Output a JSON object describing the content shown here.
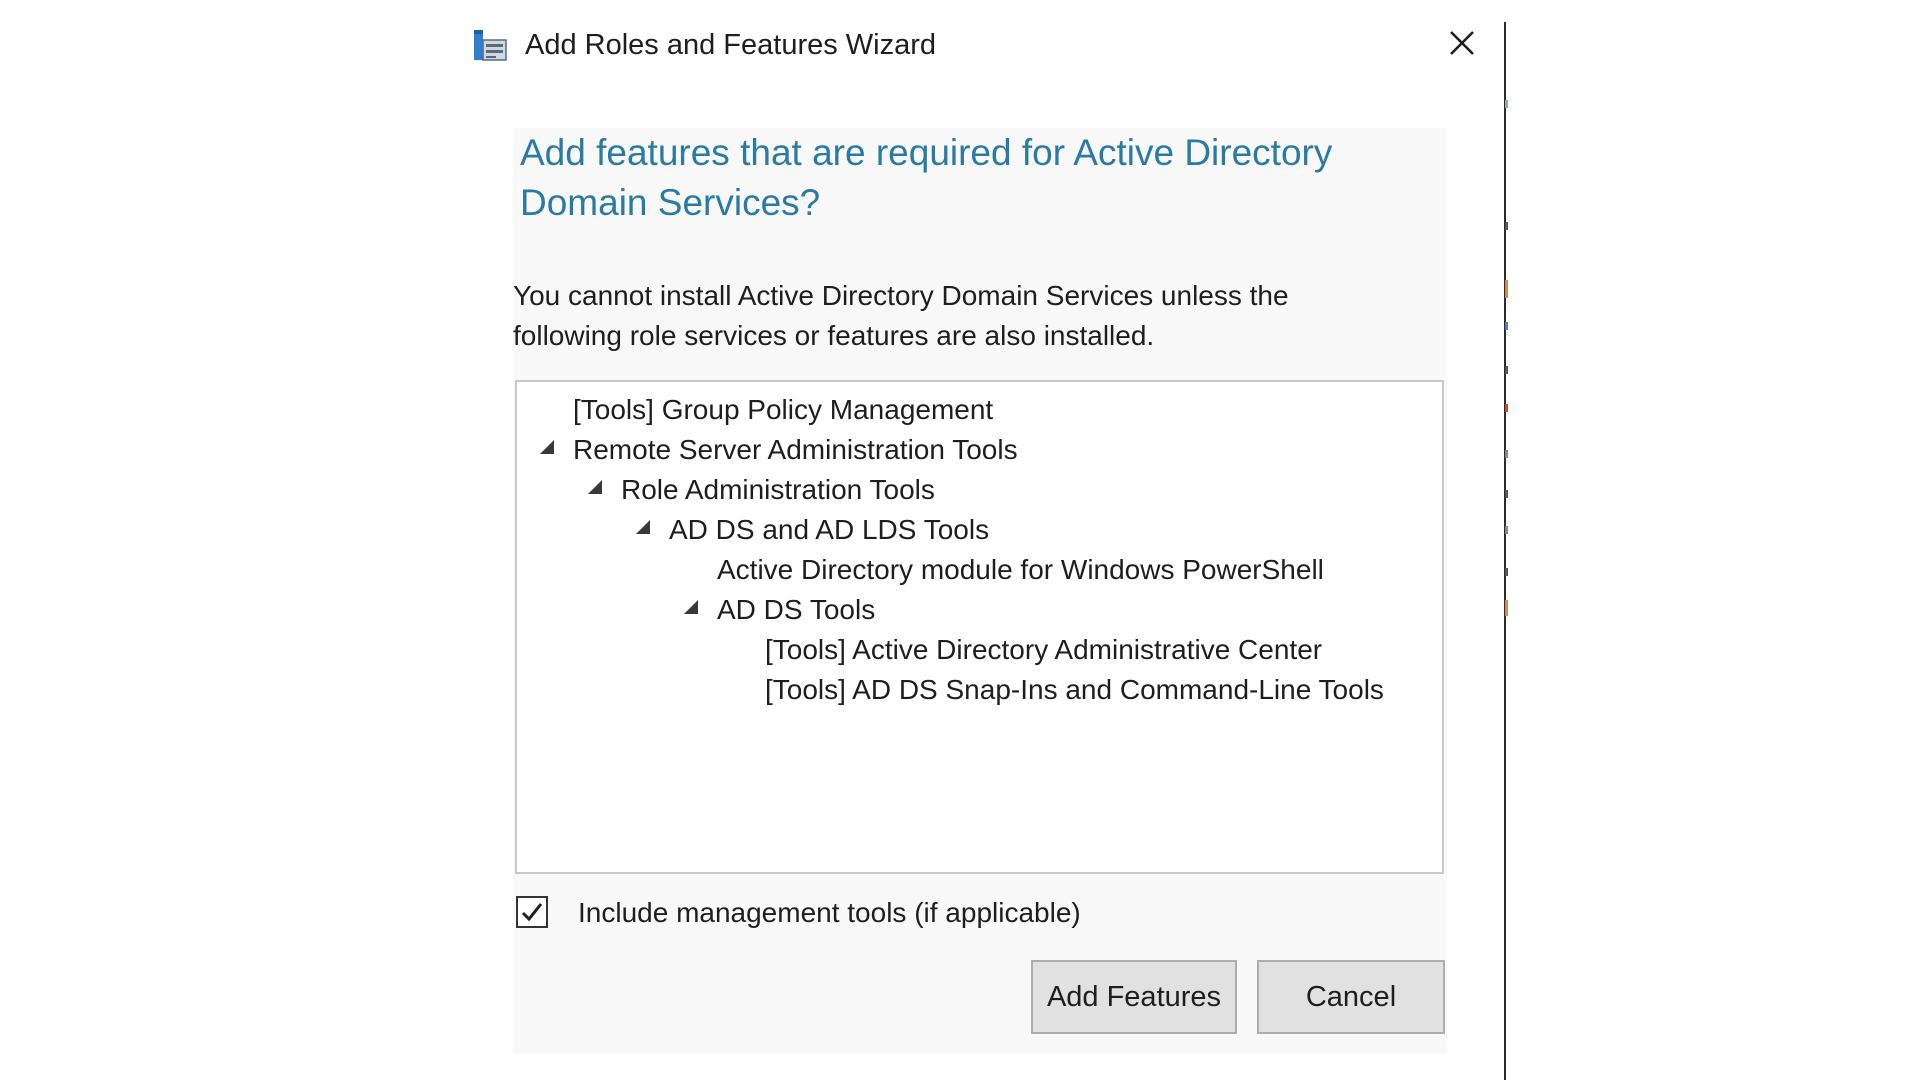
{
  "window": {
    "title": "Add Roles and Features Wizard",
    "icon": "server-manager-icon",
    "close_icon": "close-icon"
  },
  "dialog": {
    "heading": "Add features that are required for Active Directory Domain Services?",
    "description": "You cannot install Active Directory Domain Services unless the following role services or features are also installed.",
    "tree": [
      {
        "label": "[Tools] Group Policy Management",
        "level": 0,
        "expandable": false
      },
      {
        "label": "Remote Server Administration Tools",
        "level": 0,
        "expandable": true,
        "expanded": true
      },
      {
        "label": "Role Administration Tools",
        "level": 1,
        "expandable": true,
        "expanded": true
      },
      {
        "label": "AD DS and AD LDS Tools",
        "level": 2,
        "expandable": true,
        "expanded": true
      },
      {
        "label": "Active Directory module for Windows PowerShell",
        "level": 3,
        "expandable": false
      },
      {
        "label": "AD DS Tools",
        "level": 3,
        "expandable": true,
        "expanded": true
      },
      {
        "label": "[Tools] Active Directory Administrative Center",
        "level": 4,
        "expandable": false
      },
      {
        "label": "[Tools] AD DS Snap-Ins and Command-Line Tools",
        "level": 4,
        "expandable": false
      }
    ],
    "include_tools": {
      "label": "Include management tools (if applicable)",
      "checked": true
    },
    "buttons": {
      "add_features": "Add Features",
      "cancel": "Cancel"
    }
  },
  "colors": {
    "heading": "#2a7aa6",
    "panel_bg": "#f8f8f8",
    "button_bg": "#e1e1e1",
    "button_border": "#adadad"
  }
}
